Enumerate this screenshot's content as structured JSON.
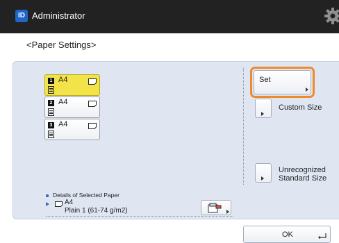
{
  "header": {
    "badge_text": "ID",
    "user_name": "Administrator",
    "settings_icon": "gear-icon"
  },
  "page": {
    "title": "<Paper Settings>"
  },
  "paper_sources": [
    {
      "number": "1",
      "size": "A4",
      "selected": true
    },
    {
      "number": "2",
      "size": "A4",
      "selected": false
    },
    {
      "number": "3",
      "size": "A4",
      "selected": false
    }
  ],
  "actions": {
    "set_label": "Set",
    "custom_size_label": "Custom Size",
    "unrecognized_line1": "Unrecognized",
    "unrecognized_line2": "Standard Size"
  },
  "details": {
    "label": "Details of Selected Paper",
    "size": "A4",
    "type": "Plain 1 (61-74 g/m2)"
  },
  "footer": {
    "ok_label": "OK"
  },
  "colors": {
    "accent_orange": "#ef8a2b",
    "selected_yellow": "#f2e448",
    "badge_blue": "#1f66c9",
    "panel_bg": "#dfe6f2"
  }
}
